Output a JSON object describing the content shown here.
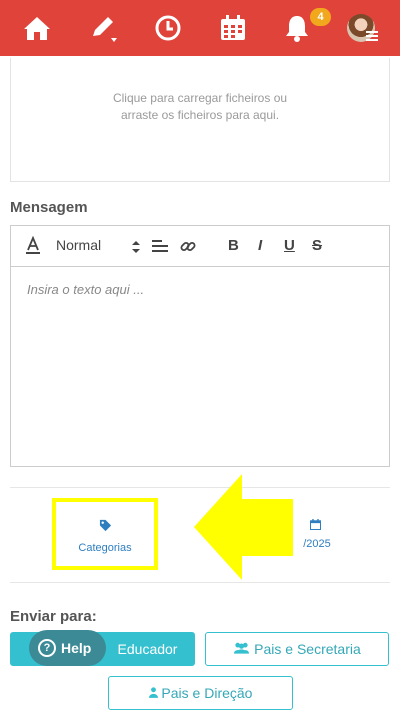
{
  "nav": {
    "items": [
      {
        "name": "home-icon"
      },
      {
        "name": "pencil-icon"
      },
      {
        "name": "clock-icon"
      },
      {
        "name": "calendar-icon"
      },
      {
        "name": "bell-icon"
      }
    ],
    "notification_count": "4"
  },
  "upload": {
    "line1": "Clique para carregar ficheiros ou",
    "line2": "arraste os ficheiros para aqui."
  },
  "message": {
    "label": "Mensagem",
    "format_select": "Normal",
    "placeholder": "Insira o texto aqui ..."
  },
  "meta": {
    "categories_label": "Categorias",
    "date_label": "/2025"
  },
  "send": {
    "label": "Enviar para:",
    "buttons": [
      "Educador",
      "Pais e Secretaria",
      "Pais e Direção"
    ]
  },
  "help": {
    "label": "Help"
  },
  "colors": {
    "topbar": "#e0433a",
    "accent": "#35c0cf",
    "link": "#2f7fc0",
    "highlight": "#ffff00",
    "badge": "#f2a81d"
  }
}
